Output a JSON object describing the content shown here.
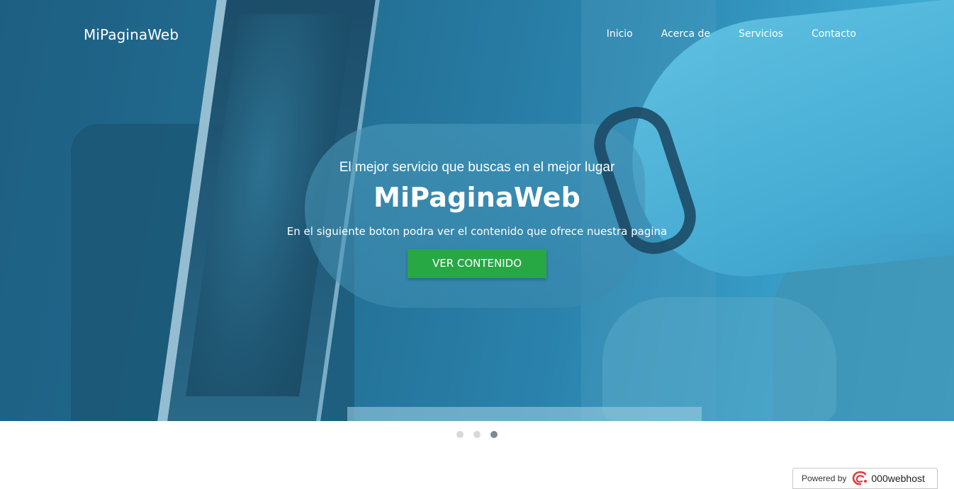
{
  "navbar": {
    "brand": "MiPaginaWeb",
    "links": [
      {
        "label": "Inicio"
      },
      {
        "label": "Acerca de"
      },
      {
        "label": "Servicios"
      },
      {
        "label": "Contacto"
      }
    ]
  },
  "hero": {
    "subtitle": "El mejor servicio que buscas en el mejor lugar",
    "title": "MiPaginaWeb",
    "description": "En el siguiente boton podra ver el contenido que ofrece nuestra pagina",
    "button_label": "VER CONTENIDO",
    "overlay_color": "#236f94",
    "button_color": "#28a745"
  },
  "carousel": {
    "slide_count": 3,
    "active_slide": 3
  },
  "badge": {
    "prefix": "Powered by",
    "brand": "000webhost",
    "logo_icon": "000webhost-logo-icon",
    "logo_color": "#e03a3e"
  }
}
